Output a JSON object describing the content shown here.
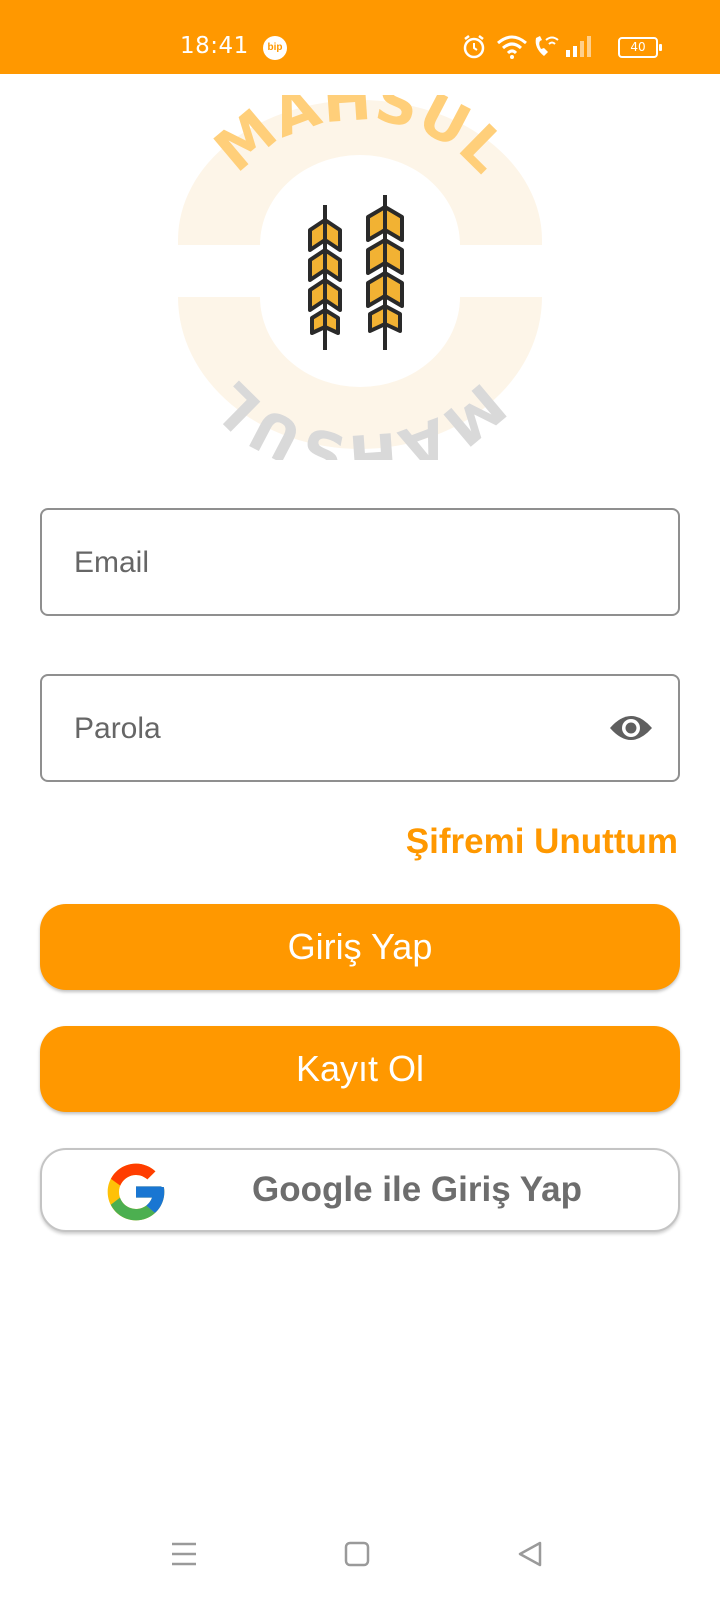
{
  "status_bar": {
    "time": "18:41",
    "app_badge": "bip",
    "battery_level": "40"
  },
  "logo": {
    "text_top": "MAHSUL",
    "text_bottom": "MAHSUL",
    "icon": "wheat-icon"
  },
  "form": {
    "email_placeholder": "Email",
    "password_placeholder": "Parola",
    "forgot_password": "Şifremi Unuttum"
  },
  "buttons": {
    "login": "Giriş Yap",
    "register": "Kayıt Ol",
    "google_login": "Google ile Giriş Yap"
  },
  "colors": {
    "accent": "#ff9800",
    "white": "#ffffff",
    "google_text": "#6d6d6d"
  },
  "nav_bar": {
    "icons": [
      "menu-icon",
      "home-icon",
      "back-icon"
    ]
  }
}
